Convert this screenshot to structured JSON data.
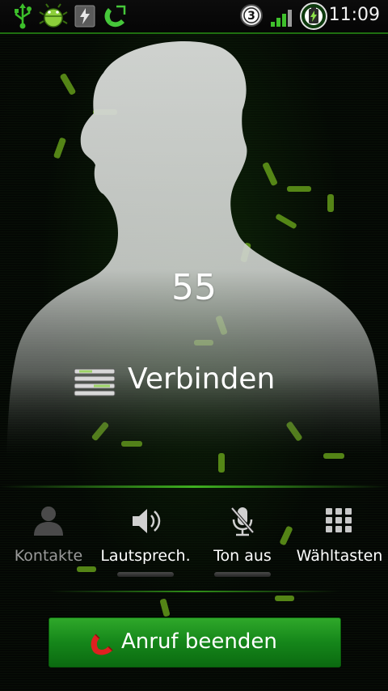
{
  "status_bar": {
    "time": "11:09",
    "network_badge": "3",
    "icons": [
      "usb-icon",
      "android-debug-icon",
      "battery-charging-icon",
      "call-in-progress-icon",
      "network-3g-icon",
      "signal-strength-icon",
      "battery-icon"
    ]
  },
  "call": {
    "number": "55",
    "status": "Verbinden"
  },
  "controls": {
    "contacts_label": "Kontakte",
    "speaker_label": "Lautsprech.",
    "mute_label": "Ton aus",
    "dialpad_label": "Wähltasten"
  },
  "end_call": {
    "label": "Anruf beenden"
  },
  "colors": {
    "accent": "#2fa82a",
    "end_call_icon": "#e02020",
    "disabled_text": "#9a9a9a"
  }
}
